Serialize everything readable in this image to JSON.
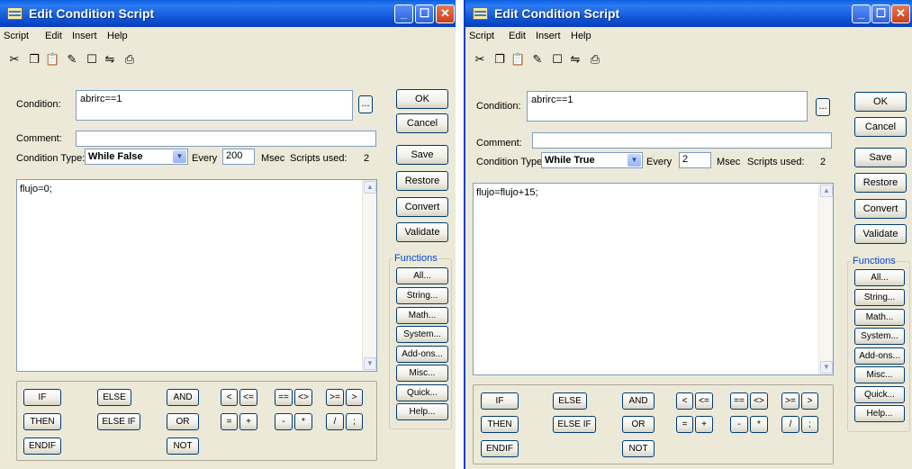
{
  "dialogs": [
    {
      "title": "Edit Condition Script",
      "menu": [
        "Script",
        "Edit",
        "Insert",
        "Help"
      ],
      "toolbar_icons": [
        "cut-icon",
        "copy-icon",
        "paste-icon",
        "convert-icon",
        "window-icon",
        "replace-icon",
        "print-icon"
      ],
      "condition_label": "Condition:",
      "condition_value": "abrirc==1",
      "ellipsis_label": "...",
      "comment_label": "Comment:",
      "comment_value": "",
      "condition_type_label": "Condition Type:",
      "condition_type_value": "While False",
      "every_label": "Every",
      "every_value": "200",
      "msec_label": "Msec",
      "scripts_used_label": "Scripts used:",
      "scripts_used_value": "2",
      "script_text": "flujo=0;",
      "buttons": {
        "ok": "OK",
        "cancel": "Cancel",
        "save": "Save",
        "restore": "Restore",
        "convert": "Convert",
        "validate": "Validate"
      },
      "functions_label": "Functions",
      "functions": {
        "all": "All...",
        "string": "String...",
        "math": "Math...",
        "system": "System...",
        "addons": "Add-ons...",
        "misc": "Misc...",
        "quick": "Quick...",
        "help": "Help..."
      },
      "ops": {
        "if": "IF",
        "else": "ELSE",
        "and": "AND",
        "then": "THEN",
        "elseif": "ELSE IF",
        "or": "OR",
        "endif": "ENDIF",
        "not": "NOT",
        "lt": "<",
        "le": "<=",
        "eq": "==",
        "ne": "<>",
        "ge": ">=",
        "gt": ">",
        "assign": "=",
        "plus": "+",
        "minus": "-",
        "mult": "*",
        "div": "/",
        "semi": ";"
      }
    },
    {
      "title": "Edit Condition Script",
      "menu": [
        "Script",
        "Edit",
        "Insert",
        "Help"
      ],
      "toolbar_icons": [
        "cut-icon",
        "copy-icon",
        "paste-icon",
        "convert-icon",
        "window-icon",
        "replace-icon",
        "print-icon"
      ],
      "condition_label": "Condition:",
      "condition_value": "abrirc==1",
      "ellipsis_label": "...",
      "comment_label": "Comment:",
      "comment_value": "",
      "condition_type_label": "Condition Type:",
      "condition_type_value": "While True",
      "every_label": "Every",
      "every_value": "2",
      "msec_label": "Msec",
      "scripts_used_label": "Scripts used:",
      "scripts_used_value": "2",
      "script_text": "flujo=flujo+15;",
      "buttons": {
        "ok": "OK",
        "cancel": "Cancel",
        "save": "Save",
        "restore": "Restore",
        "convert": "Convert",
        "validate": "Validate"
      },
      "functions_label": "Functions",
      "functions": {
        "all": "All...",
        "string": "String...",
        "math": "Math...",
        "system": "System...",
        "addons": "Add-ons...",
        "misc": "Misc...",
        "quick": "Quick...",
        "help": "Help..."
      },
      "ops": {
        "if": "IF",
        "else": "ELSE",
        "and": "AND",
        "then": "THEN",
        "elseif": "ELSE IF",
        "or": "OR",
        "endif": "ENDIF",
        "not": "NOT",
        "lt": "<",
        "le": "<=",
        "eq": "==",
        "ne": "<>",
        "ge": ">=",
        "gt": ">",
        "assign": "=",
        "plus": "+",
        "minus": "-",
        "mult": "*",
        "div": "/",
        "semi": ";"
      }
    }
  ]
}
